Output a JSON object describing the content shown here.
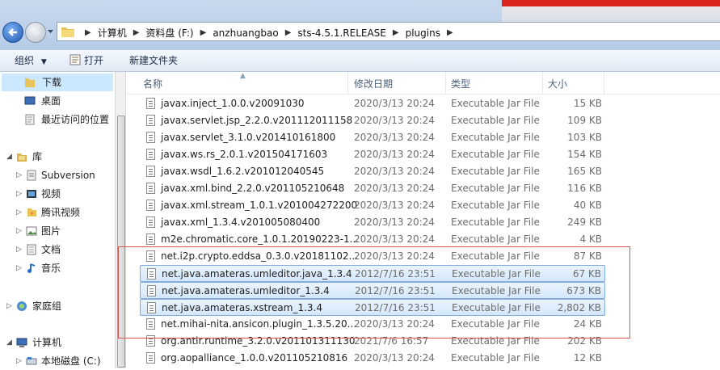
{
  "address": {
    "crumbs": [
      "计算机",
      "资料盘 (F:)",
      "anzhuangbao",
      "sts-4.5.1.RELEASE",
      "plugins"
    ]
  },
  "toolbar": {
    "organize": "组织",
    "open": "打开",
    "new_folder": "新建文件夹"
  },
  "nav": {
    "downloads": "下载",
    "desktop": "桌面",
    "recent": "最近访问的位置",
    "libraries": "库",
    "subversion": "Subversion",
    "videos": "视频",
    "tencent_video": "腾讯视频",
    "pictures": "图片",
    "documents": "文档",
    "music": "音乐",
    "homegroup": "家庭组",
    "computer": "计算机",
    "local_disk": "本地磁盘 (C:)"
  },
  "columns": {
    "name": "名称",
    "date": "修改日期",
    "type": "类型",
    "size": "大小"
  },
  "files": [
    {
      "name": "javax.inject_1.0.0.v20091030",
      "date": "2020/3/13 20:24",
      "type": "Executable Jar File",
      "size": "15 KB"
    },
    {
      "name": "javax.servlet.jsp_2.2.0.v201112011158",
      "date": "2020/3/13 20:24",
      "type": "Executable Jar File",
      "size": "109 KB"
    },
    {
      "name": "javax.servlet_3.1.0.v201410161800",
      "date": "2020/3/13 20:24",
      "type": "Executable Jar File",
      "size": "103 KB"
    },
    {
      "name": "javax.ws.rs_2.0.1.v201504171603",
      "date": "2020/3/13 20:24",
      "type": "Executable Jar File",
      "size": "154 KB"
    },
    {
      "name": "javax.wsdl_1.6.2.v201012040545",
      "date": "2020/3/13 20:24",
      "type": "Executable Jar File",
      "size": "165 KB"
    },
    {
      "name": "javax.xml.bind_2.2.0.v201105210648",
      "date": "2020/3/13 20:24",
      "type": "Executable Jar File",
      "size": "116 KB"
    },
    {
      "name": "javax.xml.stream_1.0.1.v201004272200",
      "date": "2020/3/13 20:24",
      "type": "Executable Jar File",
      "size": "40 KB"
    },
    {
      "name": "javax.xml_1.3.4.v201005080400",
      "date": "2020/3/13 20:24",
      "type": "Executable Jar File",
      "size": "249 KB"
    },
    {
      "name": "m2e.chromatic.core_1.0.1.20190223-1...",
      "date": "2020/3/13 20:24",
      "type": "Executable Jar File",
      "size": "4 KB"
    },
    {
      "name": "net.i2p.crypto.eddsa_0.3.0.v20181102...",
      "date": "2020/3/13 20:24",
      "type": "Executable Jar File",
      "size": "87 KB"
    },
    {
      "name": "net.java.amateras.umleditor.java_1.3.4",
      "date": "2012/7/16 23:51",
      "type": "Executable Jar File",
      "size": "67 KB",
      "selected": true
    },
    {
      "name": "net.java.amateras.umleditor_1.3.4",
      "date": "2012/7/16 23:51",
      "type": "Executable Jar File",
      "size": "673 KB",
      "selected": true
    },
    {
      "name": "net.java.amateras.xstream_1.3.4",
      "date": "2012/7/16 23:51",
      "type": "Executable Jar File",
      "size": "2,802 KB",
      "selected": true
    },
    {
      "name": "net.mihai-nita.ansicon.plugin_1.3.5.20...",
      "date": "2020/3/13 20:24",
      "type": "Executable Jar File",
      "size": "24 KB"
    },
    {
      "name": "org.antlr.runtime_3.2.0.v201101311130",
      "date": "2021/7/6 16:57",
      "type": "Executable Jar File",
      "size": "202 KB"
    },
    {
      "name": "org.aopalliance_1.0.0.v201105210816",
      "date": "2020/3/13 20:24",
      "type": "Executable Jar File",
      "size": "12 KB"
    }
  ],
  "colors": {
    "selection_fill": "#d3e7fb",
    "selection_border": "#84acdd",
    "annotation_red": "#d9534f"
  }
}
